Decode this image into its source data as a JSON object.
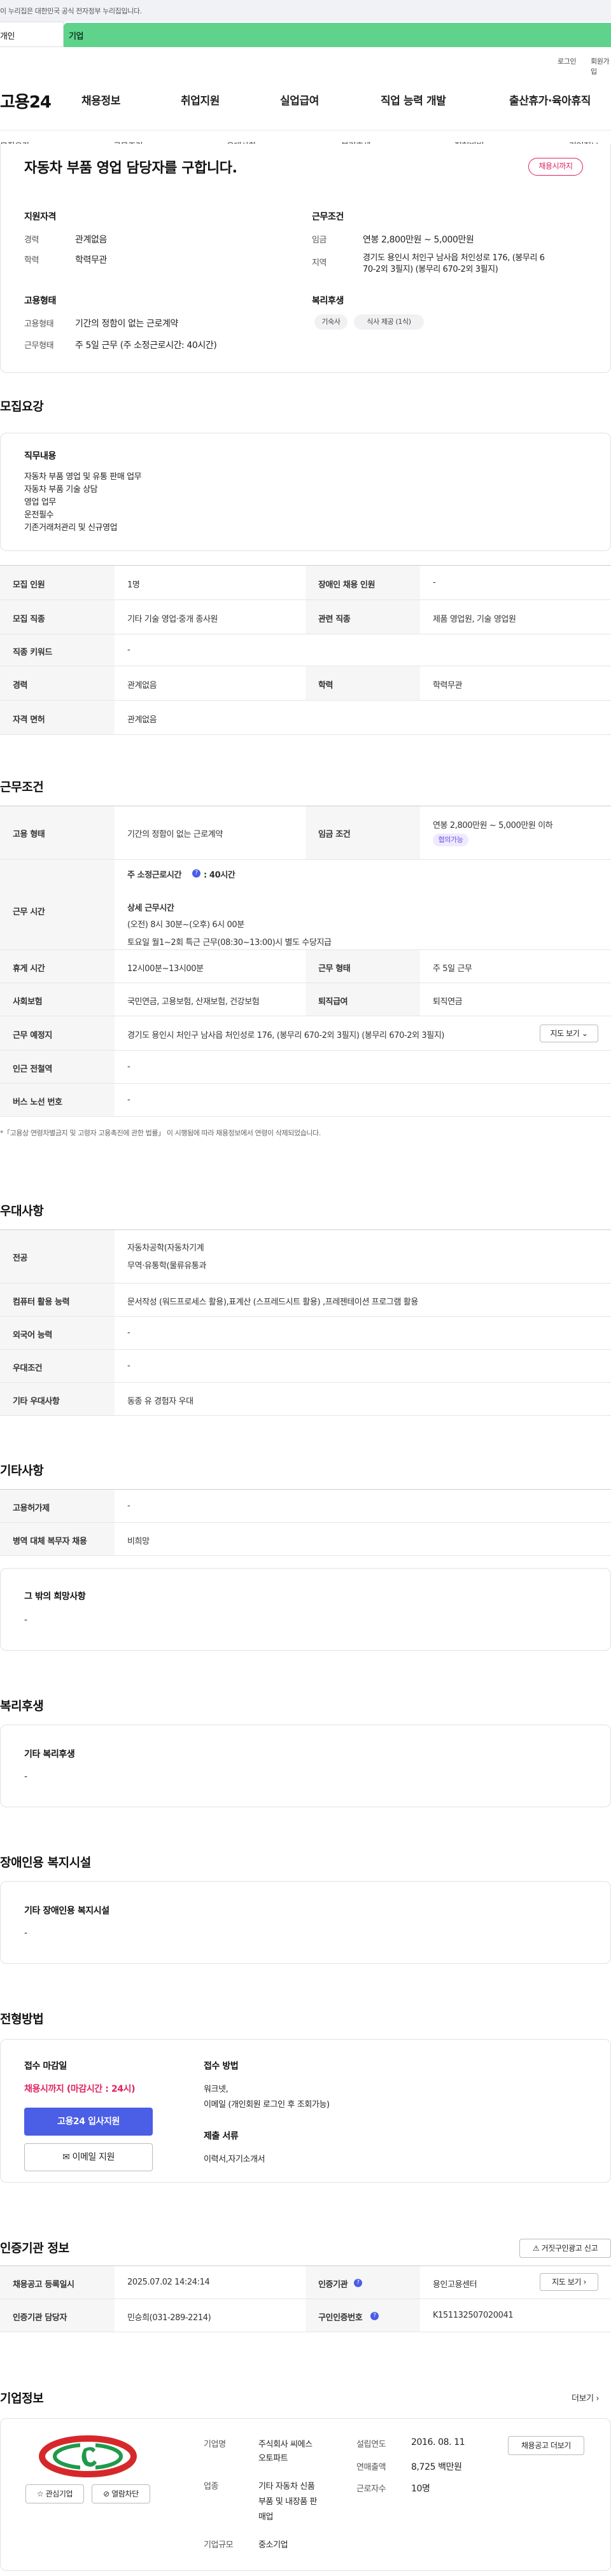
{
  "gov_banner": "이 누리집은 대한민국 공식 전자정부 누리집입니다.",
  "tabs": {
    "personal": "개인",
    "corp": "기업"
  },
  "util": {
    "login": "로그인",
    "join": "회원가입"
  },
  "header": {
    "logo": "고용24",
    "gnb": [
      "채용정보",
      "취업지원",
      "실업급여",
      "직업 능력 개발",
      "출산휴가·육아휴직"
    ]
  },
  "subnav": [
    "모집요강",
    "근무조건",
    "우대사항",
    "복리후생",
    "전형방법",
    "기업정보"
  ],
  "summary": {
    "title": "자동차 부품 영업 담당자를 구합니다.",
    "deadline_badge": "채용시까지",
    "qual_title": "지원자격",
    "qual_rows": [
      {
        "label": "경력",
        "value": "관계없음"
      },
      {
        "label": "학력",
        "value": "학력무관"
      }
    ],
    "cond_title": "근무조건",
    "cond_rows": [
      {
        "label": "임금",
        "value": "연봉 2,800만원 ~ 5,000만원"
      },
      {
        "label": "지역",
        "value": "경기도 용인시 처인구 남사읍 처인성로 176, (봉무리 6",
        "value2": "70-2외 3필지) (봉무리 670-2외 3필지)"
      }
    ],
    "emp_title": "고용형태",
    "emp_rows": [
      {
        "label": "고용형태",
        "value": "기간의 정함이 없는 근로계약"
      },
      {
        "label": "근무형태",
        "value": "주 5일 근무 (주 소정근로시간: 40시간)"
      }
    ],
    "welfare_title": "복리후생",
    "welfare_chips": [
      "기숙사",
      "식사 제공 (1식)"
    ]
  },
  "recruit": {
    "heading": "모집요강",
    "duty_title": "직무내용",
    "duty_lines": [
      "자동차 부품 영업 및 유통 판매 업무",
      "자동차 부품 기술 상담",
      "영업 업무",
      "운전필수",
      "기존거래처관리 및 신규영업"
    ],
    "rows": [
      {
        "l1": "모집 인원",
        "v1": "1명",
        "l2": "장애인 채용 인원",
        "v2": "-"
      },
      {
        "l1": "모집 직종",
        "v1": "기타 기술 영업·중개 종사원",
        "l2": "관련 직종",
        "v2": "제품 영업원, 기술 영업원"
      },
      {
        "l1": "직종 키워드",
        "v1": "-"
      },
      {
        "l1": "경력",
        "v1": "관계없음",
        "l2": "학력",
        "v2": "학력무관"
      },
      {
        "l1": "자격 면허",
        "v1": "관계없음"
      }
    ]
  },
  "work": {
    "heading": "근무조건",
    "employ_label": "고용 형태",
    "employ_value": "기간의 정함이 없는 근로계약",
    "wage_label": "임금 조건",
    "wage_value": "연봉 2,800만원 ~ 5,000만원 이하",
    "wage_pill": "협의가능",
    "time_label": "근무 시간",
    "time_main_prefix": "주 소정근로시간",
    "time_main_value": ": 40시간",
    "time_detail_title": "상세 근무시간",
    "time_detail_1": "(오전) 8시 30분~(오후) 6시 00분",
    "time_detail_2": "토요일 월1~2회 특근 근무(08:30~13:00)시 별도 수당지급",
    "rest_label": "휴게 시간",
    "rest_value": "12시00분~13시00분",
    "form_label": "근무 형태",
    "form_value": "주 5일 근무",
    "ins_label": "사회보험",
    "ins_value": "국민연금, 고용보험, 산재보험, 건강보험",
    "ret_label": "퇴직급여",
    "ret_value": "퇴직연금",
    "loc_label": "근무 예정지",
    "loc_value": "경기도 용인시 처인구 남사읍 처인성로 176, (봉무리 670-2외 3필지) (봉무리 670-2외 3필지)",
    "map_btn": "지도 보기",
    "subway_label": "인근 전철역",
    "subway_value": "-",
    "bus_label": "버스 노선 번호",
    "bus_value": "-",
    "note": "*「고용상 연령차별금지 및 고령자 고용촉진에 관한 법률」 이 시행됨에 따라 채용정보에서 연령이 삭제되었습니다."
  },
  "pref": {
    "heading": "우대사항",
    "major_label": "전공",
    "major_1": "자동차공학(자동차기계",
    "major_2": "무역·유통학(물류유통과",
    "pc_label": "컴퓨터 활용 능력",
    "pc_value": "문서작성 (워드프로세스 활용),표계산 (스프레드시트 활용) ,프레젠테이션 프로그램 활용",
    "lang_label": "외국어 능력",
    "lang_value": "-",
    "cond_label": "우대조건",
    "cond_value": "-",
    "etc_label": "기타 우대사항",
    "etc_value": "동종 유 경험자 우대"
  },
  "other": {
    "heading": "기타사항",
    "r1_label": "고용허가제",
    "r1_value": "-",
    "r2_label": "병역 대체 복무자 채용",
    "r2_value": "비희망",
    "box_title": "그 밖의 희망사항",
    "box_value": "-"
  },
  "welfare": {
    "heading": "복리후생",
    "box_title": "기타 복리후생",
    "box_value": "-"
  },
  "disability": {
    "heading": "장애인용 복지시설",
    "box_title": "기타 장애인용 복지시설",
    "box_value": "-"
  },
  "process": {
    "heading": "전형방법",
    "deadline_title": "접수 마감일",
    "deadline_value": "채용시까지 (마감시간 : 24시)",
    "apply_btn": "고용24 입사지원",
    "email_btn": "이메일 지원",
    "method_title": "접수 방법",
    "method_1": "워크넷,",
    "method_2": "이메일 (개인회원 로그인 후 조회가능)",
    "docs_title": "제출 서류",
    "docs_value": "이력서,자기소개서"
  },
  "cert": {
    "heading": "인증기관 정보",
    "report_btn": "거짓구인광고 신고",
    "reg_label": "채용공고 등록일시",
    "reg_value": "2025.07.02 14:24:14",
    "org_label": "인증기관",
    "org_value": "용인고용센터",
    "map_btn": "지도 보기",
    "mgr_label": "인증기관 담당자",
    "mgr_value": "민승희(031-289-2214)",
    "no_label": "구인인증번호",
    "no_value": "K151132507020041"
  },
  "company": {
    "heading": "기업정보",
    "more": "더보기",
    "fav_btn": "관심기업",
    "block_btn": "열람차단",
    "name_label": "기업명",
    "name_1": "주식회사 씨에스",
    "name_2": "오토파트",
    "biz_label": "업종",
    "biz_1": "기타 자동차 신품",
    "biz_2": "부품 및 내장품 판",
    "biz_3": "매업",
    "size_label": "기업규모",
    "size_value": "중소기업",
    "est_label": "설립연도",
    "est_value": "2016. 08. 11",
    "sales_label": "연매출액",
    "sales_value": "8,725 백만원",
    "emp_label": "근로자수",
    "emp_value": "10명",
    "jobs_btn": "채용공고 더보기"
  },
  "colors": {
    "green": "#5fd38b",
    "red": "#e0245e",
    "blue": "#4a5ee6"
  }
}
